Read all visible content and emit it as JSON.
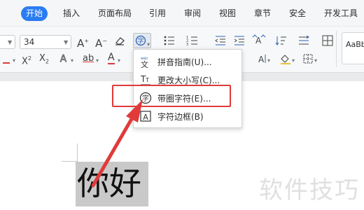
{
  "tabs": [
    "开始",
    "插入",
    "页面布局",
    "引用",
    "审阅",
    "视图",
    "章节",
    "安全",
    "开发工具"
  ],
  "toolbar": {
    "font_size": "34",
    "style_preview": "AaBb"
  },
  "menu": {
    "items": [
      {
        "label": "拼音指南(U)...",
        "icon": "pinyin-guide-icon"
      },
      {
        "label": "更改大小写(C)...",
        "icon": "change-case-icon"
      },
      {
        "label": "带圈字符(E)...",
        "icon": "enclosed-character-icon"
      },
      {
        "label": "字符边框(B)",
        "icon": "character-border-icon"
      }
    ]
  },
  "document": {
    "selected_text": "你好"
  },
  "watermark": "软件技巧",
  "colors": {
    "active_tab": "#2b7cf3",
    "highlight": "#e03a3a",
    "selection": "#c9c9c9"
  }
}
